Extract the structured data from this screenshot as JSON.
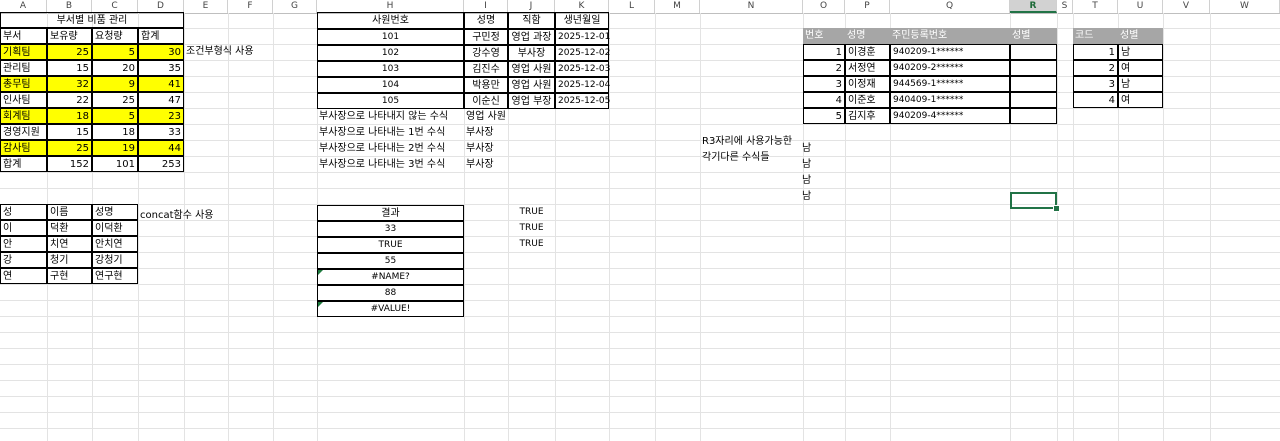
{
  "columns": [
    "A",
    "B",
    "C",
    "D",
    "E",
    "F",
    "G",
    "H",
    "I",
    "J",
    "K",
    "L",
    "M",
    "N",
    "O",
    "P",
    "Q",
    "R",
    "S",
    "T",
    "U",
    "V",
    "W"
  ],
  "selected_column": "R",
  "colors": {
    "highlight": "#ffff00",
    "header_gray": "#a6a6a6",
    "selection": "#217346"
  },
  "supplies": {
    "title": "부서별 비품 관리",
    "headers": [
      "부서",
      "보유량",
      "요청량",
      "합계"
    ],
    "rows": [
      {
        "dept": "기획팀",
        "have": "25",
        "req": "5",
        "sum": "30",
        "hl": true
      },
      {
        "dept": "관리팀",
        "have": "15",
        "req": "20",
        "sum": "35",
        "hl": false
      },
      {
        "dept": "총무팀",
        "have": "32",
        "req": "9",
        "sum": "41",
        "hl": true
      },
      {
        "dept": "인사팀",
        "have": "22",
        "req": "25",
        "sum": "47",
        "hl": false
      },
      {
        "dept": "회계팀",
        "have": "18",
        "req": "5",
        "sum": "23",
        "hl": true
      },
      {
        "dept": "경영지원",
        "have": "15",
        "req": "18",
        "sum": "33",
        "hl": false
      },
      {
        "dept": "감사팀",
        "have": "25",
        "req": "19",
        "sum": "44",
        "hl": true
      }
    ],
    "total": {
      "dept": "합계",
      "have": "152",
      "req": "101",
      "sum": "253"
    },
    "note": "조건부형식 사용"
  },
  "names": {
    "headers": [
      "성",
      "이름",
      "성명"
    ],
    "rows": [
      {
        "last": "이",
        "first": "덕환",
        "full": "이덕환"
      },
      {
        "last": "안",
        "first": "치연",
        "full": "안치연"
      },
      {
        "last": "강",
        "first": "청기",
        "full": "강청기"
      },
      {
        "last": "연",
        "first": "구현",
        "full": "연구현"
      }
    ],
    "note": "concat함수 사용"
  },
  "employees": {
    "headers": [
      "사원번호",
      "성명",
      "직함",
      "생년월일"
    ],
    "rows": [
      {
        "id": "101",
        "name": "구민정",
        "title": "영업 과장",
        "dob": "2025-12-01"
      },
      {
        "id": "102",
        "name": "강수영",
        "title": "부사장",
        "dob": "2025-12-02"
      },
      {
        "id": "103",
        "name": "김진수",
        "title": "영업 사원",
        "dob": "2025-12-03"
      },
      {
        "id": "104",
        "name": "박용만",
        "title": "영업 사원",
        "dob": "2025-12-04"
      },
      {
        "id": "105",
        "name": "이순신",
        "title": "영업 부장",
        "dob": "2025-12-05"
      }
    ],
    "formula_lines": [
      {
        "label": "부사장으로 나타내지 않는 수식",
        "value": "영업 사원"
      },
      {
        "label": "부사장으로 나타내는 1번 수식",
        "value": "부사장"
      },
      {
        "label": "부사장으로 나타내는 2번 수식",
        "value": "부사장"
      },
      {
        "label": "부사장으로 나타내는 3번 수식",
        "value": "부사장"
      }
    ]
  },
  "results": {
    "header": "결과",
    "values": [
      "33",
      "TRUE",
      "55",
      "#NAME?",
      "88",
      "#VALUE!"
    ],
    "side": [
      "TRUE",
      "TRUE",
      "TRUE"
    ]
  },
  "gender_note": {
    "line1": "R3자리에 사용가능한",
    "line2": "각기다른 수식들",
    "values": [
      "남",
      "남",
      "남",
      "남"
    ]
  },
  "ssn": {
    "headers": [
      "번호",
      "성명",
      "주민등록번호",
      "성별"
    ],
    "rows": [
      {
        "no": "1",
        "name": "이경훈",
        "ssn": "940209-1******"
      },
      {
        "no": "2",
        "name": "서정연",
        "ssn": "940209-2******"
      },
      {
        "no": "3",
        "name": "이정재",
        "ssn": "944569-1******"
      },
      {
        "no": "4",
        "name": "이준호",
        "ssn": "940409-1******"
      },
      {
        "no": "5",
        "name": "김지후",
        "ssn": "940209-4******"
      }
    ]
  },
  "codes": {
    "headers": [
      "코드",
      "성별"
    ],
    "rows": [
      {
        "code": "1",
        "gender": "남"
      },
      {
        "code": "2",
        "gender": "여"
      },
      {
        "code": "3",
        "gender": "남"
      },
      {
        "code": "4",
        "gender": "여"
      }
    ]
  }
}
